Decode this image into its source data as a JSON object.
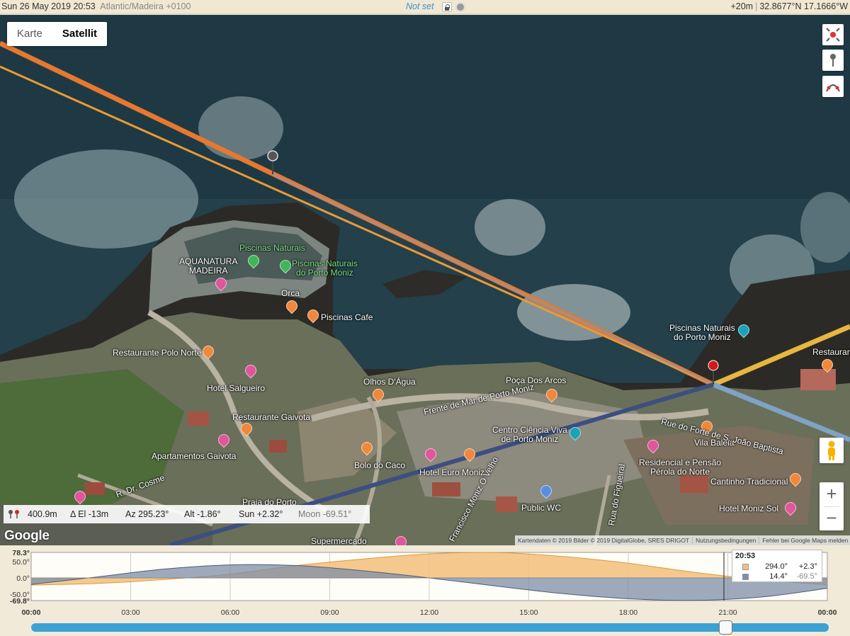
{
  "topbar": {
    "datetime": "Sun 26 May 2019 20:53",
    "timezone": "Atlantic/Madeira +0100",
    "status": "Not set",
    "elevation": "+20m",
    "coordinates": "32.8677°N 17.1666°W"
  },
  "map": {
    "type_buttons": [
      "Karte",
      "Satellit"
    ],
    "active_type": "Satellit",
    "labels": {
      "piscinas_naturais": "Piscinas Naturais",
      "piscinas_naturais_porto_moniz_1": "Piscinas Naturais\ndo Porto Moniz",
      "aquanatura": "AQUANATURA\nMADEIRA",
      "orca": "Orca",
      "piscinas_cafe": "Piscinas Cafe",
      "restaurante_polo_norte": "Restaurante Polo Norte",
      "hotel_salgueiro": "Hotel Salgueiro",
      "restaurante_gaivota": "Restaurante Gaivota",
      "apartamentos_gaivota": "Apartamentos Gaivota",
      "olhos_dagua": "Olhos D'Água",
      "poca_dos_arcos": "Poça Dos Arcos",
      "frente_de_mar": "Frente de Mar de Porto Moniz",
      "centro_ciencia": "Centro Ciência Viva\nde Porto Moniz",
      "bolo_do_caco": "Bolo do Caco",
      "hotel_euro_moniz": "Hotel Euro Moniz",
      "public_wc": "Public WC",
      "rua_do_figueiral": "Rua do Figueiral",
      "residencial": "Residencial e Pensão\nPérola do Norte",
      "vila_baleia": "Vila Baleia",
      "cantinho": "Cantinho Tradicional",
      "hotel_moniz_sol": "Hotel Moniz Sol",
      "rua_do_forte": "Rue do Forte de S. João Baptista",
      "piscinas_naturais_porto_moniz_2": "Piscinas Naturais\ndo Porto Moniz",
      "restaurant_edge": "Restaurant",
      "supermercado": "Supermercado",
      "praia": "Praia do Porto",
      "r_dr_cosme": "R. Dr. Cosme",
      "francisco": "Francisco Moniz O Velho"
    },
    "info": {
      "distance": "400.9m",
      "delta_el": "Δ El  -13m",
      "azimuth": "Az 295.23°",
      "altitude": "Alt  -1.86°",
      "sun": "Sun +2.32°",
      "moon": "Moon -69.51°"
    },
    "google_logo": "Google",
    "attribution": [
      "Kartendaten © 2019 Bilder © 2019 DigitalGlobe, SRES DRIGOT",
      "Nutzungsbedingungen",
      "Fehler bei Google Maps melden"
    ]
  },
  "chart_data": {
    "type": "area",
    "x_ticks": [
      "00:00",
      "03:00",
      "06:00",
      "09:00",
      "12:00",
      "15:00",
      "18:00",
      "21:00",
      "00:00"
    ],
    "y_ticks": [
      "78.3°",
      "50.0°",
      "0.0°",
      "-50.0°",
      "-69.8°"
    ],
    "ylim": [
      -69.8,
      78.3
    ],
    "series": [
      {
        "name": "Sun",
        "color": "#f3c07a",
        "x": [
          0,
          2,
          4,
          6,
          8,
          10,
          12,
          14,
          16,
          18,
          20,
          22,
          24
        ],
        "values": [
          -22,
          -17,
          -5,
          12,
          38,
          58,
          74,
          78,
          66,
          45,
          17,
          -6,
          -21
        ]
      },
      {
        "name": "Moon",
        "color": "#7d8ea8",
        "x": [
          0,
          2,
          4,
          6,
          8,
          10,
          12,
          14,
          16,
          18,
          20,
          22,
          24
        ],
        "values": [
          -20,
          3,
          27,
          40,
          38,
          22,
          0,
          -25,
          -48,
          -64,
          -69,
          -59,
          -32
        ]
      }
    ],
    "current_time": "20:53",
    "current_hour": 20.883,
    "legend": {
      "time": "20:53",
      "sun": {
        "azimuth": "294.0°",
        "altitude": "+2.3°"
      },
      "moon": {
        "azimuth": "14.4°",
        "altitude": "-69.5°"
      }
    },
    "slider_fraction": 0.87
  }
}
